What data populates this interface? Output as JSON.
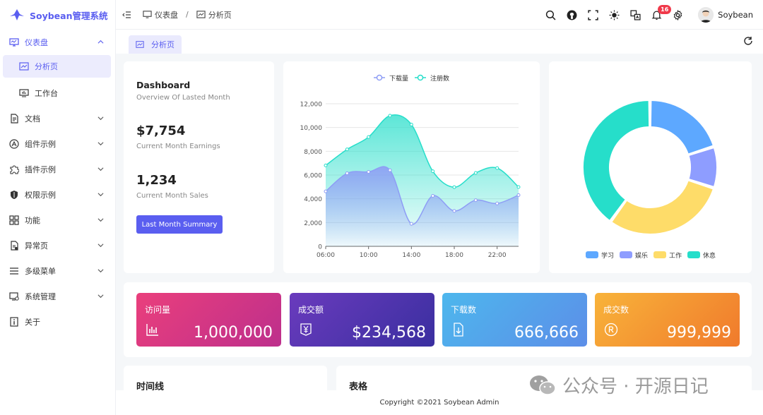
{
  "app": {
    "title": "Soybean管理系统"
  },
  "sidebar": {
    "items": [
      {
        "label": "仪表盘",
        "icon": "monitor-icon"
      },
      {
        "label": "分析页",
        "icon": "chart-image-icon"
      },
      {
        "label": "工作台",
        "icon": "workbench-icon"
      },
      {
        "label": "文档",
        "icon": "document-icon"
      },
      {
        "label": "组件示例",
        "icon": "component-icon"
      },
      {
        "label": "插件示例",
        "icon": "plugin-icon"
      },
      {
        "label": "权限示例",
        "icon": "shield-icon"
      },
      {
        "label": "功能",
        "icon": "grid-icon"
      },
      {
        "label": "异常页",
        "icon": "exception-icon"
      },
      {
        "label": "多级菜单",
        "icon": "list-icon"
      },
      {
        "label": "系统管理",
        "icon": "system-icon"
      },
      {
        "label": "关于",
        "icon": "info-icon"
      }
    ]
  },
  "header": {
    "breadcrumb": [
      "仪表盘",
      "分析页"
    ],
    "notification_count": "16",
    "user_name": "Soybean"
  },
  "tabs": [
    {
      "label": "分析页"
    }
  ],
  "summary": {
    "title": "Dashboard",
    "subtitle": "Overview Of Lasted Month",
    "earnings_value": "$7,754",
    "earnings_label": "Current Month Earnings",
    "sales_value": "1,234",
    "sales_label": "Current Month Sales",
    "button_label": "Last Month Summary"
  },
  "chart_data": [
    {
      "type": "area",
      "title": "",
      "x": [
        "06:00",
        "08:00",
        "10:00",
        "12:00",
        "14:00",
        "16:00",
        "18:00",
        "20:00",
        "22:00",
        "24:00"
      ],
      "x_tick_labels": [
        "06:00",
        "10:00",
        "14:00",
        "18:00",
        "22:00"
      ],
      "y_tick_labels": [
        "0",
        "2,000",
        "4,000",
        "6,000",
        "8,000",
        "10,000",
        "12,000"
      ],
      "ylim": [
        0,
        12000
      ],
      "legend": "top-center",
      "grid": true,
      "series": [
        {
          "name": "下载量",
          "color": "#8e9df5",
          "values": [
            4623,
            6145,
            6268,
            6411,
            1890,
            4251,
            2978,
            3880,
            3606,
            4311
          ]
        },
        {
          "name": "注册数",
          "color": "#26deca",
          "values": [
            6809,
            8160,
            9198,
            10998,
            10250,
            6316,
            4980,
            6180,
            6587,
            4988
          ]
        }
      ]
    },
    {
      "type": "pie",
      "title": "",
      "legend": "bottom-center",
      "categories": [
        "学习",
        "娱乐",
        "工作",
        "休息"
      ],
      "values": [
        20,
        10,
        30,
        40
      ],
      "colors": [
        "#5da8ff",
        "#8e9dff",
        "#fedc69",
        "#26deca"
      ]
    }
  ],
  "stats": [
    {
      "title": "访问量",
      "value": "1,000,000",
      "icon": "bar-chart-icon"
    },
    {
      "title": "成交额",
      "value": "$234,568",
      "icon": "money-icon"
    },
    {
      "title": "下载数",
      "value": "666,666",
      "icon": "download-file-icon"
    },
    {
      "title": "成交数",
      "value": "999,999",
      "icon": "registered-icon"
    }
  ],
  "sections": {
    "timeline_title": "时间线",
    "table_title": "表格"
  },
  "footer": {
    "text": "Copyright ©2021 Soybean Admin"
  },
  "watermark": {
    "text": "公众号 · 开源日记"
  }
}
